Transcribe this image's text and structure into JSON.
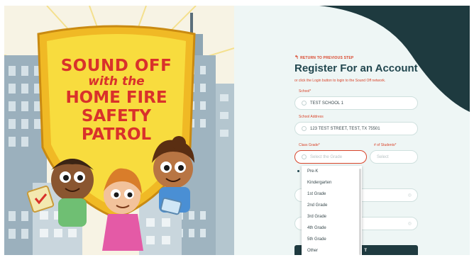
{
  "illustration": {
    "title_lines": [
      "SOUND OFF",
      "with the",
      "HOME FIRE",
      "SAFETY",
      "PATROL"
    ]
  },
  "register": {
    "back_link": "RETURN TO PREVIOUS STEP",
    "title": "Register For an Account",
    "subtitle": "or click the Login button to login to the Sound Off network.",
    "school_label": "School*",
    "school_value": "TEST SCHOOL 1",
    "address_label": "School Address",
    "address_value": "123 TEST STREET, TEST, TX 75501",
    "class_grade_label": "Class Grade*",
    "class_grade_placeholder": "Select the Grade",
    "students_label": "# of Students*",
    "students_placeholder": "Select",
    "grade_options": [
      "Pre-K",
      "Kindergarten",
      "1st Grade",
      "2nd Grade",
      "3rd Grade",
      "4th Grade",
      "5th Grade",
      "Other"
    ],
    "submit_label": "T"
  },
  "colors": {
    "accent": "#d9452b",
    "title": "#22474f",
    "panel_bg": "#eef6f5",
    "button": "#1f3b40"
  }
}
